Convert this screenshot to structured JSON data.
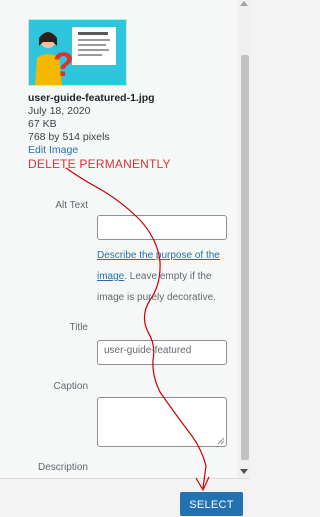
{
  "attachment": {
    "thumbnail_icon": "user-guide-illustration",
    "filename": "user-guide-featured-1.jpg",
    "date": "July 18, 2020",
    "size": "67 KB",
    "dimensions": "768 by 514 pixels",
    "edit_label": "Edit Image",
    "delete_label": "DELETE PERMANENTLY"
  },
  "fields": {
    "alt_text": {
      "label": "Alt Text",
      "value": "",
      "help_link": "Describe the purpose of the image",
      "help_rest": ". Leave empty if the image is purely decorative."
    },
    "title": {
      "label": "Title",
      "value": "user-guide-featured"
    },
    "caption": {
      "label": "Caption",
      "value": ""
    },
    "description": {
      "label": "Description"
    }
  },
  "footer": {
    "select_label": "SELECT"
  },
  "colors": {
    "accent": "#2271b1",
    "danger": "#d63638",
    "annotation": "#cc0000"
  }
}
